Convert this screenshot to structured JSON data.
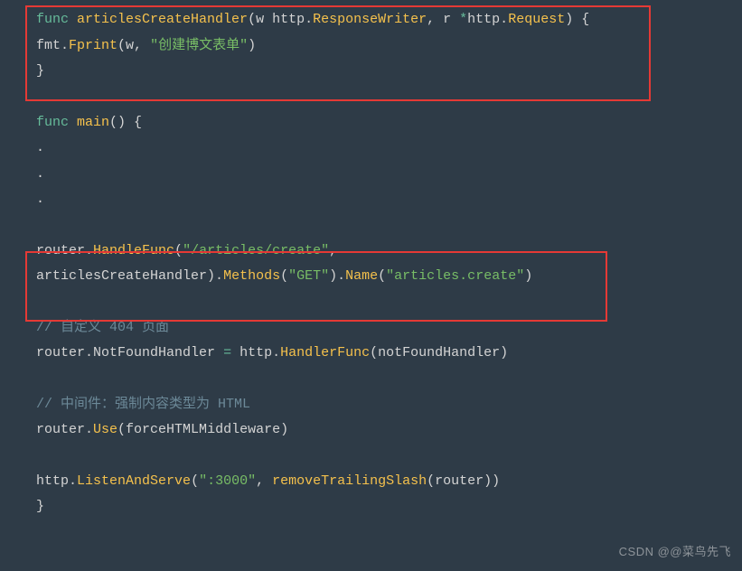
{
  "code": {
    "l1_func": "func",
    "l1_name": "articlesCreateHandler",
    "l1_sig_a": "(w http",
    "l1_sig_b": "ResponseWriter",
    "l1_sig_c": ", r ",
    "l1_star": "*",
    "l1_sig_d": "http",
    "l1_sig_e": "Request",
    "l1_sig_f": ") {",
    "l2_a": "fmt",
    "l2_b": "Fprint",
    "l2_c": "(w, ",
    "l2_str": "\"创建博文表单\"",
    "l2_d": ")",
    "l3": "}",
    "l5_func": "func",
    "l5_name": "main",
    "l5_sig": "() {",
    "l6_dot": ".",
    "l7_dot": ".",
    "l8_dot": ".",
    "l10_a": "router",
    "l10_b": "HandleFunc",
    "l10_c": "(",
    "l10_str": "\"/articles/create\"",
    "l10_d": ",",
    "l11_a": "articlesCreateHandler)",
    "l11_b": "Methods",
    "l11_c": "(",
    "l11_str1": "\"GET\"",
    "l11_d": ")",
    "l11_e": "Name",
    "l11_f": "(",
    "l11_str2": "\"articles.create\"",
    "l11_g": ")",
    "l13_comment": "// 自定义 404 页面",
    "l14_a": "router",
    "l14_b": "NotFoundHandler ",
    "l14_eq": "=",
    "l14_c": " http",
    "l14_d": "HandlerFunc",
    "l14_e": "(notFoundHandler)",
    "l16_comment": "// 中间件：强制内容类型为 HTML",
    "l17_a": "router",
    "l17_b": "Use",
    "l17_c": "(forceHTMLMiddleware)",
    "l19_a": "http",
    "l19_b": "ListenAndServe",
    "l19_c": "(",
    "l19_str": "\":3000\"",
    "l19_d": ", ",
    "l19_e": "removeTrailingSlash",
    "l19_f": "(router))",
    "l20": "}"
  },
  "watermark": "CSDN @@菜鸟先飞"
}
